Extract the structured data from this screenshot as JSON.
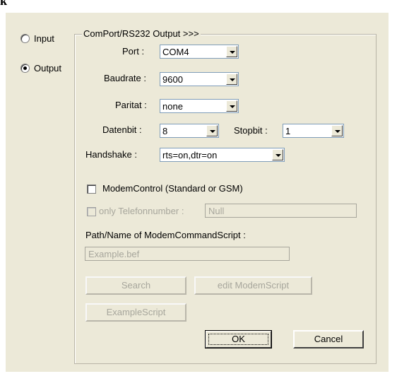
{
  "corner_text": "k",
  "mode": {
    "input_label": "Input",
    "output_label": "Output",
    "selected": "Output"
  },
  "group": {
    "title": "ComPort/RS232 Output >>>",
    "port": {
      "label": "Port :",
      "value": "COM4"
    },
    "baudrate": {
      "label": "Baudrate :",
      "value": "9600"
    },
    "paritat": {
      "label": "Paritat :",
      "value": "none"
    },
    "datenbit": {
      "label": "Datenbit :",
      "value": "8"
    },
    "stopbit": {
      "label": "Stopbit :",
      "value": "1"
    },
    "handshake": {
      "label": "Handshake :",
      "value": "rts=on,dtr=on"
    },
    "modem_control_label": "ModemControl (Standard or GSM)",
    "only_telefonnumber_label": "only Telefonnumber :",
    "telefonnumber_value": "Null",
    "script_path_label": "Path/Name of ModemCommandScript :",
    "script_path_value": "Example.bef",
    "search_button": "Search",
    "edit_button": "edit ModemScript",
    "example_button": "ExampleScript",
    "ok_button": "OK",
    "cancel_button": "Cancel"
  },
  "colors": {
    "dialog_bg": "#ece9d8",
    "disabled_text": "#a7a69c",
    "combo_border": "#7f9db9"
  }
}
